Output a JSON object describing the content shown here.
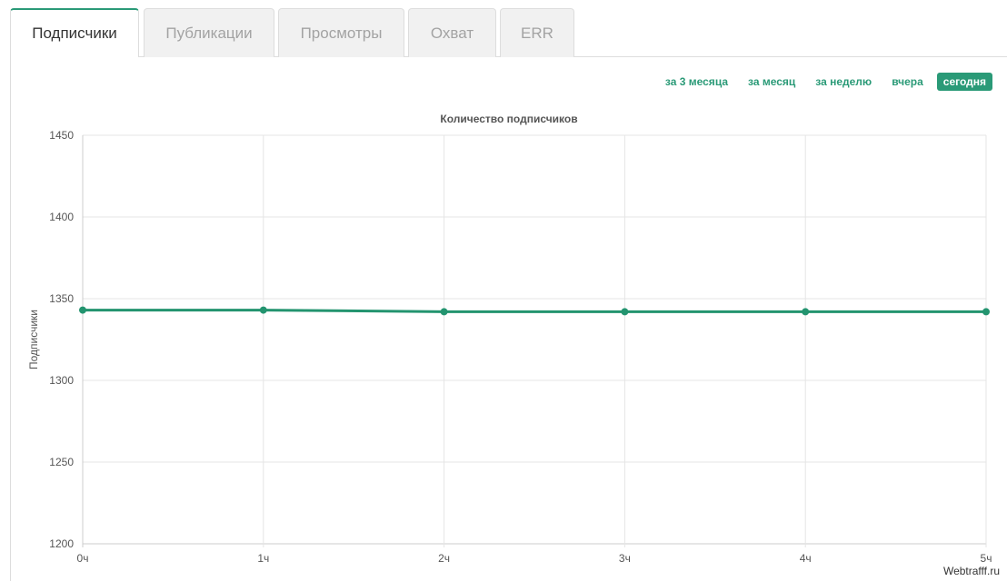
{
  "tabs": [
    {
      "label": "Подписчики",
      "active": true
    },
    {
      "label": "Публикации",
      "active": false
    },
    {
      "label": "Просмотры",
      "active": false
    },
    {
      "label": "Охват",
      "active": false
    },
    {
      "label": "ERR",
      "active": false
    }
  ],
  "periods": [
    {
      "label": "за 3 месяца",
      "active": false
    },
    {
      "label": "за месяц",
      "active": false
    },
    {
      "label": "за неделю",
      "active": false
    },
    {
      "label": "вчера",
      "active": false
    },
    {
      "label": "сегодня",
      "active": true
    }
  ],
  "watermark": "Webtrafff.ru",
  "colors": {
    "accent": "#2a9a77",
    "line": "#23946f",
    "grid": "#e5e5e5",
    "axis": "#cccccc"
  },
  "chart_data": {
    "type": "line",
    "title": "Количество подписчиков",
    "xlabel": "",
    "ylabel": "Подписчики",
    "categories": [
      "0ч",
      "1ч",
      "2ч",
      "3ч",
      "4ч",
      "5ч"
    ],
    "y_ticks": [
      1200,
      1250,
      1300,
      1350,
      1400,
      1450
    ],
    "ylim": [
      1200,
      1450
    ],
    "grid": true,
    "legend": "none",
    "series": [
      {
        "values": [
          1343,
          1343,
          1342,
          1342,
          1342,
          1342
        ]
      }
    ]
  }
}
